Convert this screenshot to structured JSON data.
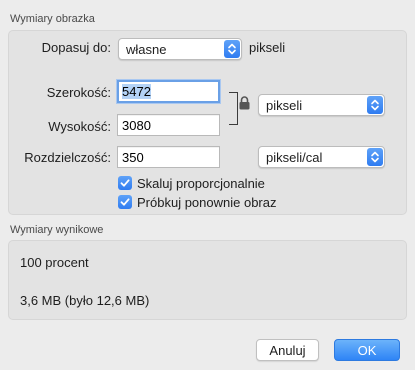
{
  "image_dimensions": {
    "title": "Wymiary obrazka",
    "fit_label": "Dopasuj do:",
    "fit_value": "własne",
    "fit_unit": "pikseli",
    "width_label": "Szerokość:",
    "width_value": "5472",
    "height_label": "Wysokość:",
    "height_value": "3080",
    "size_unit": "pikseli",
    "resolution_label": "Rozdzielczość:",
    "resolution_value": "350",
    "resolution_unit": "pikseli/cal",
    "scale_checkbox_label": "Skaluj proporcjonalnie",
    "scale_checked": true,
    "resample_checkbox_label": "Próbkuj ponownie obraz",
    "resample_checked": true
  },
  "result_dimensions": {
    "title": "Wymiary wynikowe",
    "percent_text": "100 procent",
    "size_text": "3,6 MB (było 12,6 MB)"
  },
  "buttons": {
    "cancel": "Anuluj",
    "ok": "OK"
  },
  "colors": {
    "accent": "#2f7cf1",
    "focus_ring": "#6aa0e6",
    "selection": "#b3d2f6"
  },
  "icons": {
    "lock": "lock-icon",
    "popup_arrows": "chevron-up-down-icon",
    "checkmark": "checkmark-icon"
  }
}
